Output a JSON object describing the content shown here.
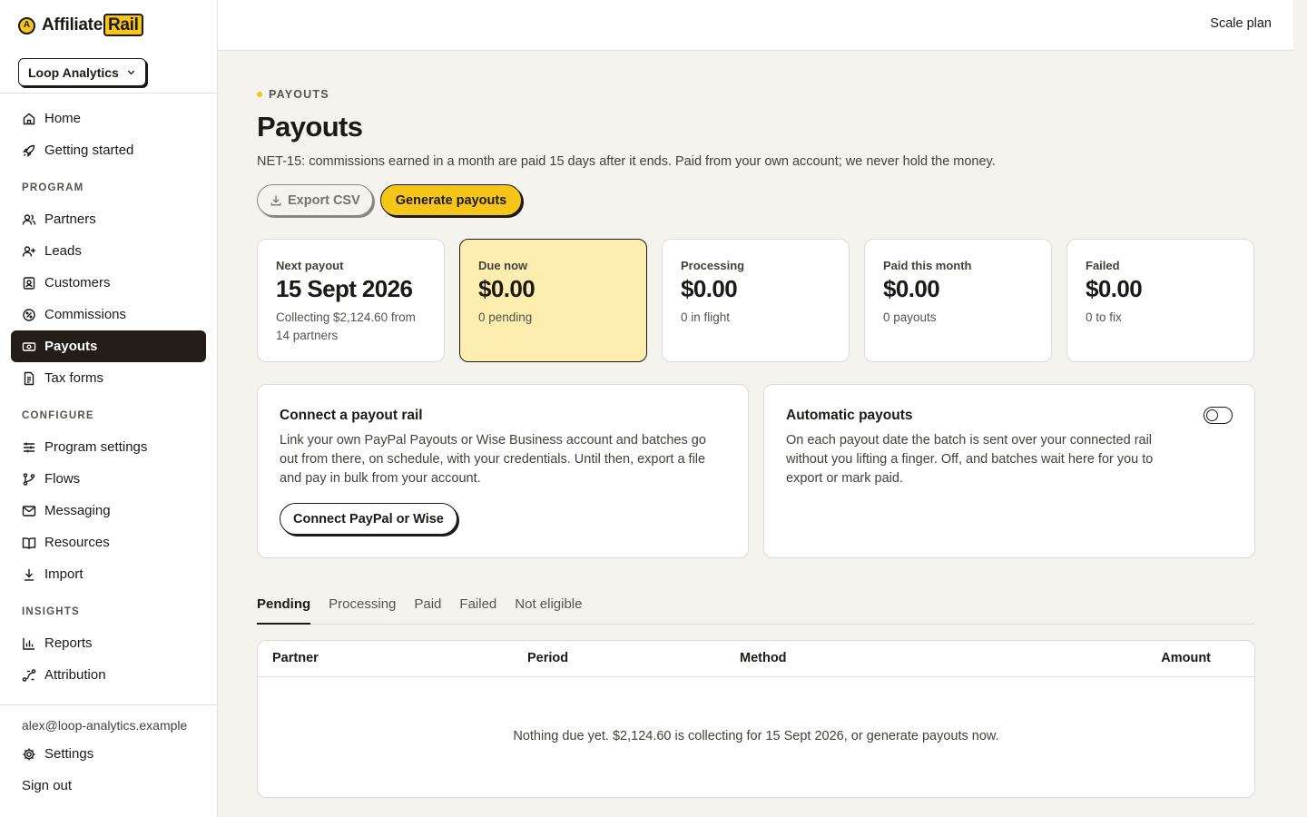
{
  "brand": {
    "name": "Affiliate",
    "accent": "Rail",
    "mark": "A"
  },
  "org": {
    "selected": "Loop Analytics"
  },
  "nav": {
    "top": [
      {
        "label": "Home",
        "icon": "home-icon"
      },
      {
        "label": "Getting started",
        "icon": "rocket-icon"
      }
    ],
    "program_label": "PROGRAM",
    "program": [
      {
        "label": "Partners",
        "icon": "users-icon"
      },
      {
        "label": "Leads",
        "icon": "user-plus-icon"
      },
      {
        "label": "Customers",
        "icon": "id-card-icon"
      },
      {
        "label": "Commissions",
        "icon": "percent-badge-icon"
      },
      {
        "label": "Payouts",
        "icon": "banknote-icon",
        "active": true
      },
      {
        "label": "Tax forms",
        "icon": "document-icon"
      }
    ],
    "configure_label": "CONFIGURE",
    "configure": [
      {
        "label": "Program settings",
        "icon": "sliders-icon"
      },
      {
        "label": "Flows",
        "icon": "git-branch-icon"
      },
      {
        "label": "Messaging",
        "icon": "mail-icon"
      },
      {
        "label": "Resources",
        "icon": "book-icon"
      },
      {
        "label": "Import",
        "icon": "download-icon"
      }
    ],
    "insights_label": "INSIGHTS",
    "insights": [
      {
        "label": "Reports",
        "icon": "bar-chart-icon"
      },
      {
        "label": "Attribution",
        "icon": "route-icon"
      }
    ]
  },
  "footer": {
    "email": "alex@loop-analytics.example",
    "settings": "Settings",
    "signout": "Sign out"
  },
  "topbar": {
    "plan": "Scale plan"
  },
  "page": {
    "eyebrow": "PAYOUTS",
    "title": "Payouts",
    "description": "NET-15: commissions earned in a month are paid 15 days after it ends. Paid from your own account; we never hold the money.",
    "export_label": "Export CSV",
    "generate_label": "Generate payouts"
  },
  "stats": [
    {
      "label": "Next payout",
      "value": "15 Sept 2026",
      "sub": "Collecting $2,124.60 from 14 partners"
    },
    {
      "label": "Due now",
      "value": "$0.00",
      "sub": "0 pending"
    },
    {
      "label": "Processing",
      "value": "$0.00",
      "sub": "0 in flight"
    },
    {
      "label": "Paid this month",
      "value": "$0.00",
      "sub": "0 payouts"
    },
    {
      "label": "Failed",
      "value": "$0.00",
      "sub": "0 to fix"
    }
  ],
  "panels": {
    "rail": {
      "title": "Connect a payout rail",
      "body": "Link your own PayPal Payouts or Wise Business account and batches go out from there, on schedule, with your credentials. Until then, export a file and pay in bulk from your account.",
      "button": "Connect PayPal or Wise"
    },
    "auto": {
      "title": "Automatic payouts",
      "body": "On each payout date the batch is sent over your connected rail without you lifting a finger. Off, and batches wait here for you to export or mark paid.",
      "enabled": false
    }
  },
  "tabs": [
    "Pending",
    "Processing",
    "Paid",
    "Failed",
    "Not eligible"
  ],
  "table": {
    "columns": [
      "Partner",
      "Period",
      "Method",
      "Amount"
    ],
    "empty": "Nothing due yet. $2,124.60 is collecting for 15 Sept 2026, or generate payouts now."
  },
  "colors": {
    "accent": "#f5c518",
    "ink": "#1c1917",
    "highlight": "#fdeeb0",
    "background": "#f4f3ee"
  }
}
